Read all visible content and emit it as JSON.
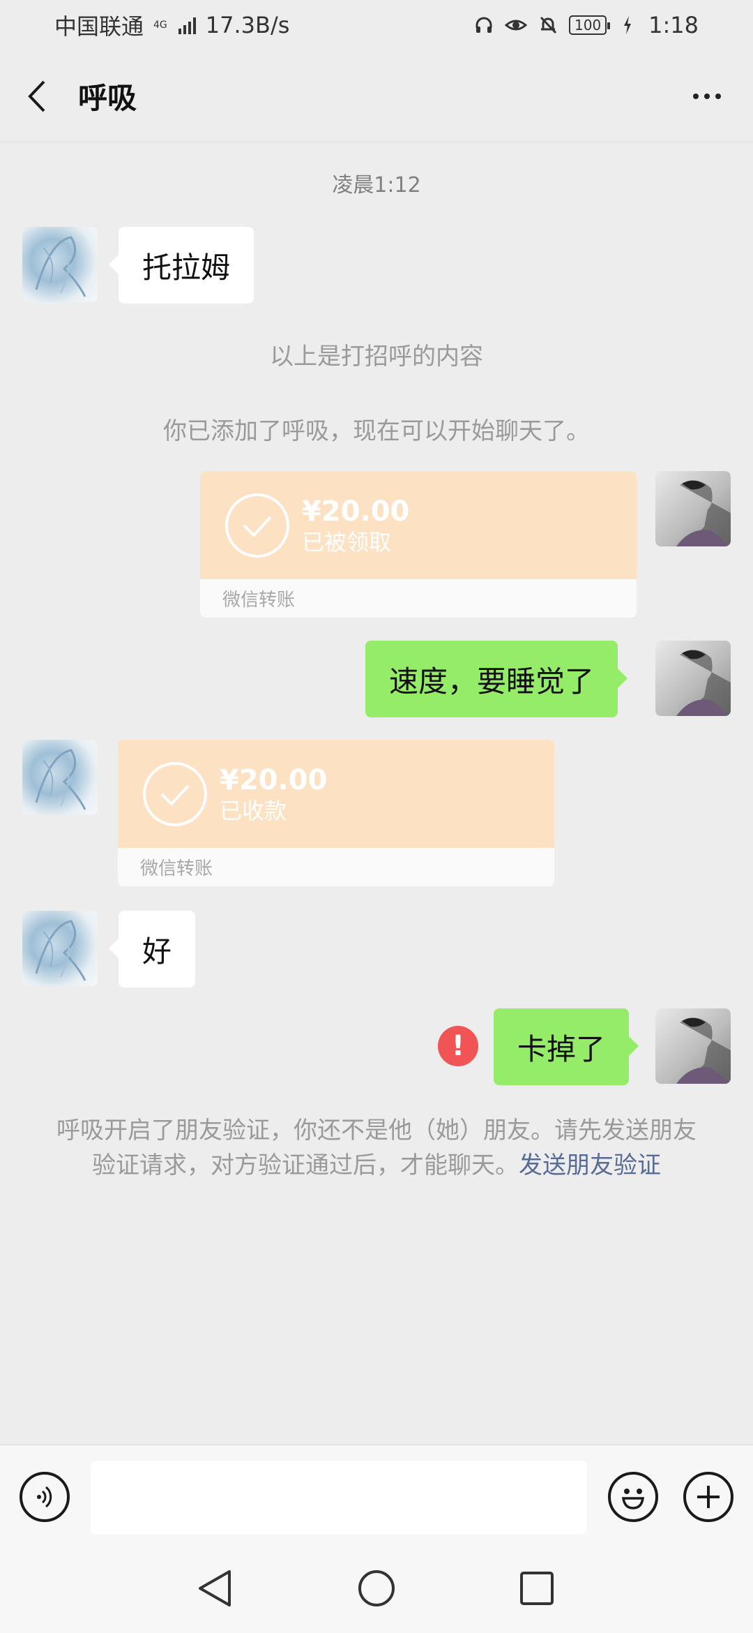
{
  "status_bar": {
    "carrier": "中国联通",
    "network_type": "4G",
    "speed": "17.3B/s",
    "battery": "100",
    "time": "1:18"
  },
  "nav": {
    "title": "呼吸"
  },
  "chat": {
    "timestamp": "凌晨1:12",
    "messages": [
      {
        "side": "left",
        "type": "text",
        "text": "托拉姆"
      },
      {
        "side": "system",
        "type": "system",
        "text": "以上是打招呼的内容"
      },
      {
        "side": "system",
        "type": "system",
        "text": "你已添加了呼吸，现在可以开始聊天了。"
      },
      {
        "side": "right",
        "type": "transfer",
        "amount": "¥20.00",
        "status": "已被领取",
        "footer": "微信转账"
      },
      {
        "side": "right",
        "type": "text",
        "text": "速度，要睡觉了"
      },
      {
        "side": "left",
        "type": "transfer",
        "amount": "¥20.00",
        "status": "已收款",
        "footer": "微信转账"
      },
      {
        "side": "left",
        "type": "text",
        "text": "好"
      },
      {
        "side": "right",
        "type": "text",
        "text": "卡掉了",
        "failed": true
      }
    ],
    "verify_notice": "呼吸开启了朋友验证，你还不是他（她）朋友。请先发送朋友验证请求，对方验证通过后，才能聊天。",
    "verify_link": "发送朋友验证"
  },
  "input_bar": {
    "value": "",
    "icons": [
      "voice-icon",
      "emoji-icon",
      "plus-icon"
    ]
  },
  "colors": {
    "chat_bg": "#ededed",
    "bubble_sent": "#95ec69",
    "bubble_received": "#ffffff",
    "transfer_bg": "#fce1c2",
    "link": "#576b95",
    "error": "#f05454"
  }
}
